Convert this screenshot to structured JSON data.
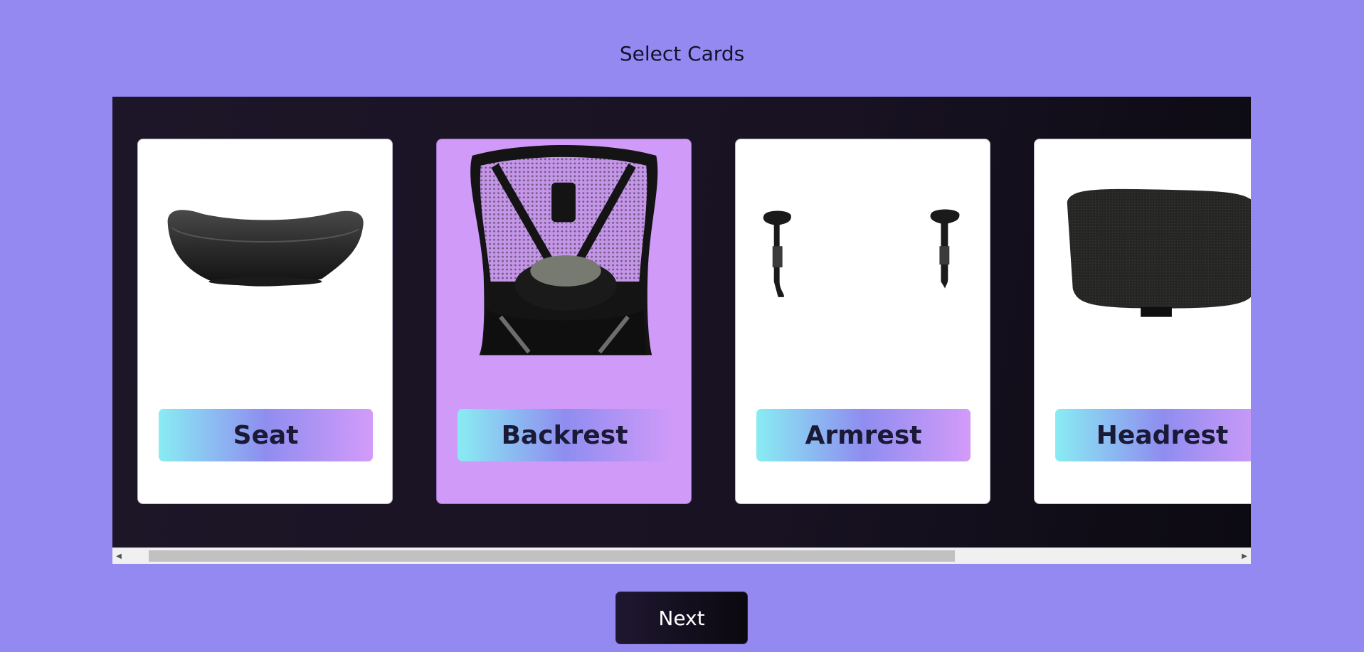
{
  "page": {
    "title": "Select Cards"
  },
  "cards": [
    {
      "label": "Seat",
      "icon": "seat-image",
      "selected": false
    },
    {
      "label": "Backrest",
      "icon": "backrest-image",
      "selected": true
    },
    {
      "label": "Armrest",
      "icon": "armrest-image",
      "selected": false
    },
    {
      "label": "Headrest",
      "icon": "headrest-image",
      "selected": false
    }
  ],
  "actions": {
    "next_label": "Next"
  },
  "scroll": {
    "left_arrow": "◀",
    "right_arrow": "▶"
  },
  "colors": {
    "page_background": "#9488f1",
    "selected_card": "#cf9af8",
    "label_gradient_start": "#89ecf3",
    "label_gradient_mid": "#8f8df0",
    "label_gradient_end": "#d39bf9"
  }
}
